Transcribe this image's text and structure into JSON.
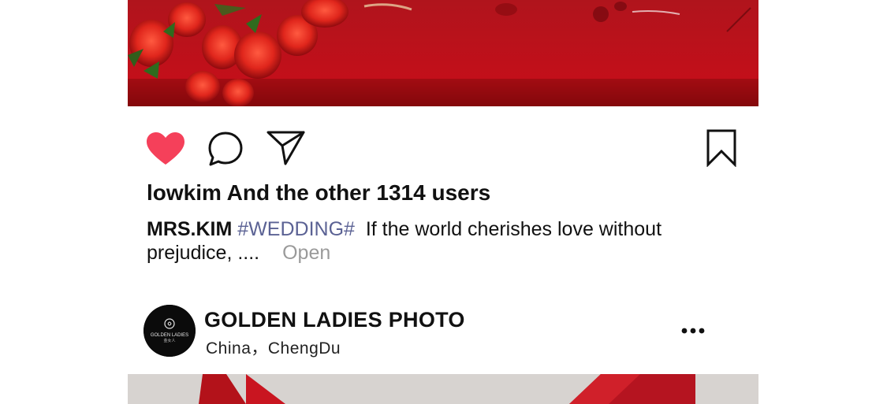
{
  "post": {
    "likes_text": "lowkim And the other 1314 users",
    "caption_user": "MRS.KIM",
    "caption_tag": "#WEDDING#",
    "caption_text": "If the world cherishes love without prejudice, ....",
    "open_label": "Open"
  },
  "actions": {
    "like_icon": "heart-icon",
    "comment_icon": "comment-bubble-icon",
    "share_icon": "paper-plane-icon",
    "save_icon": "bookmark-icon",
    "like_color": "#f5405a"
  },
  "next_post": {
    "account_name": "GOLDEN LADIES PHOTO",
    "location": "China，ChengDu",
    "avatar_logo_text": "GOLDEN LADIES",
    "avatar_logo_subtext": "金女人",
    "more_icon": "more-dots-icon"
  }
}
